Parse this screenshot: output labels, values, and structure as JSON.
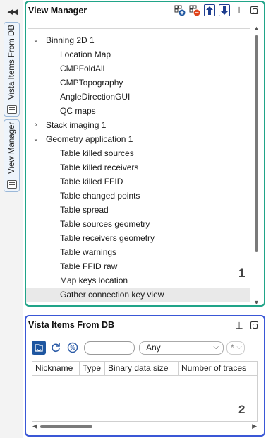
{
  "left_strip": {
    "collapse_label": "◀◀",
    "tabs": [
      {
        "label": "Vista Items From DB",
        "icon": "database-icon"
      },
      {
        "label": "View Manager",
        "icon": "windows-icon"
      }
    ]
  },
  "view_manager": {
    "title": "View Manager",
    "marker": "1",
    "tree": [
      {
        "label": "Binning 2D 1",
        "expander": "⌄"
      },
      {
        "label": "Location Map"
      },
      {
        "label": "CMPFoldAll"
      },
      {
        "label": "CMPTopography"
      },
      {
        "label": "AngleDirectionGUI"
      },
      {
        "label": "QC maps"
      },
      {
        "label": "Stack imaging 1",
        "expander": "›"
      },
      {
        "label": "Geometry application 1",
        "expander": "⌄"
      },
      {
        "label": "Table killed sources"
      },
      {
        "label": "Table killed receivers"
      },
      {
        "label": "Table killed FFID"
      },
      {
        "label": "Table changed points"
      },
      {
        "label": "Table spread"
      },
      {
        "label": "Table sources geometry"
      },
      {
        "label": "Table receivers geometry"
      },
      {
        "label": "Table warnings"
      },
      {
        "label": "Table FFID raw"
      },
      {
        "label": "Map keys location"
      },
      {
        "label": "Gather connection key view"
      }
    ]
  },
  "vista_db": {
    "title": "Vista Items From DB",
    "marker": "2",
    "search_value": "",
    "filter_select": "Any",
    "wildcard_select": "*",
    "columns": [
      "Nickname",
      "Type",
      "Binary data size",
      "Number of traces"
    ]
  },
  "colors": {
    "view_manager_border": "#20a488",
    "vista_db_border": "#3a57d6",
    "accent": "#1e56a0"
  }
}
